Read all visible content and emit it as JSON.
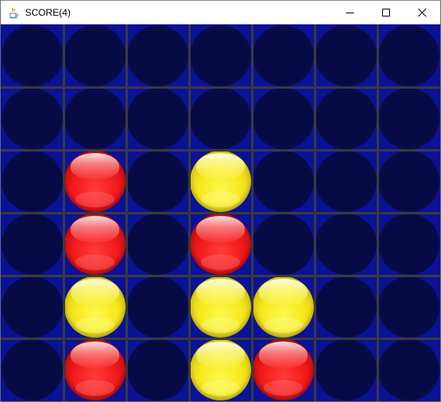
{
  "window": {
    "title": "SCORE(4)",
    "controls": [
      "minimize-icon",
      "maximize-icon",
      "close-icon"
    ]
  },
  "board": {
    "columns": 7,
    "rows": 6,
    "colors": {
      "background": "#0a1296",
      "empty_hole": "#070b45",
      "red_piece": "#f21a1a",
      "yellow_piece": "#f5e81d",
      "grid_line": "#3a3a3a"
    },
    "cells": [
      [
        "empty",
        "empty",
        "empty",
        "empty",
        "empty",
        "empty",
        "empty"
      ],
      [
        "empty",
        "empty",
        "empty",
        "empty",
        "empty",
        "empty",
        "empty"
      ],
      [
        "empty",
        "red",
        "empty",
        "yellow",
        "empty",
        "empty",
        "empty"
      ],
      [
        "empty",
        "red",
        "empty",
        "red",
        "empty",
        "empty",
        "empty"
      ],
      [
        "empty",
        "yellow",
        "empty",
        "yellow",
        "yellow",
        "empty",
        "empty"
      ],
      [
        "empty",
        "red",
        "empty",
        "yellow",
        "red",
        "empty",
        "empty"
      ]
    ]
  }
}
